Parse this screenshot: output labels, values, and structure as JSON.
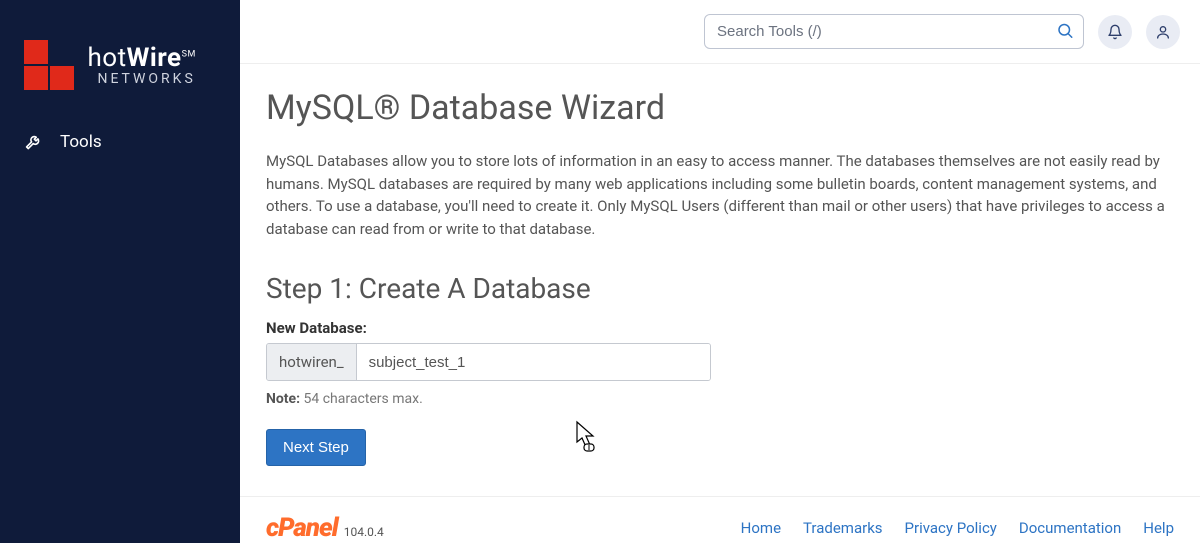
{
  "brand": {
    "name_part1": "hot",
    "name_part2": "Wire",
    "sm": "SM",
    "subtitle": "NETWORKS"
  },
  "sidebar": {
    "tools_label": "Tools"
  },
  "topbar": {
    "search_placeholder": "Search Tools (/)"
  },
  "page": {
    "title": "MySQL® Database Wizard",
    "intro": "MySQL Databases allow you to store lots of information in an easy to access manner. The databases themselves are not easily read by humans. MySQL databases are required by many web applications including some bulletin boards, content management systems, and others. To use a database, you'll need to create it. Only MySQL Users (different than mail or other users) that have privileges to access a database can read from or write to that database.",
    "step_title": "Step 1: Create A Database",
    "field_label": "New Database:",
    "prefix": "hotwiren_",
    "db_value": "subject_test_1",
    "note_label": "Note:",
    "note_text": " 54 characters max.",
    "next_btn": "Next Step"
  },
  "footer": {
    "brand": "cPanel",
    "version": "104.0.4",
    "links": {
      "home": "Home",
      "trademarks": "Trademarks",
      "privacy": "Privacy Policy",
      "docs": "Documentation",
      "help": "Help"
    }
  }
}
